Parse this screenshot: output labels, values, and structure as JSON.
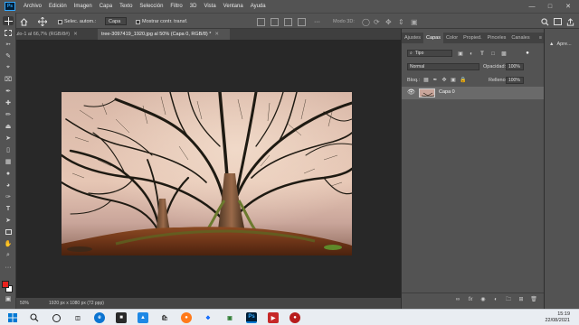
{
  "menubar": {
    "items": [
      "Archivo",
      "Edición",
      "Imagen",
      "Capa",
      "Texto",
      "Selección",
      "Filtro",
      "3D",
      "Vista",
      "Ventana",
      "Ayuda"
    ],
    "logo_text": "Ps"
  },
  "options": {
    "autoselect_label": "Selec. autom.:",
    "autoselect_value": "Capa",
    "transform_label": "Mostrar contr. transf.",
    "mode3d_label": "Modo 3D:"
  },
  "tabs": [
    {
      "label": "sin título-1 al 66,7% (RGB/8#)",
      "active": false
    },
    {
      "label": "tree-3097419_1920.jpg al 50% (Capa 0, RGB/8) *",
      "active": true
    }
  ],
  "status": {
    "zoom": "50%",
    "dimensions": "1920 px x 1080 px (72 ppp)"
  },
  "panel": {
    "tabs": [
      "Ajustes",
      "Capas",
      "Color",
      "Propied.",
      "Pinceles",
      "Canales"
    ],
    "active_tab": "Capas",
    "filter_label": "Tipo",
    "blend_mode": "Normal",
    "opacity_label": "Opacidad:",
    "opacity_value": "100%",
    "lock_label": "Bloq.:",
    "fill_label": "Relleno:",
    "fill_value": "100%",
    "layer_name": "Capa 0"
  },
  "rightstrip": {
    "learn_label": "Apre..."
  },
  "taskbar": {
    "time": "15:19",
    "date": "22/08/2021"
  },
  "colors": {
    "accent": "#31a8ff",
    "foreground": "#e8221e",
    "background": "#ffffff"
  }
}
